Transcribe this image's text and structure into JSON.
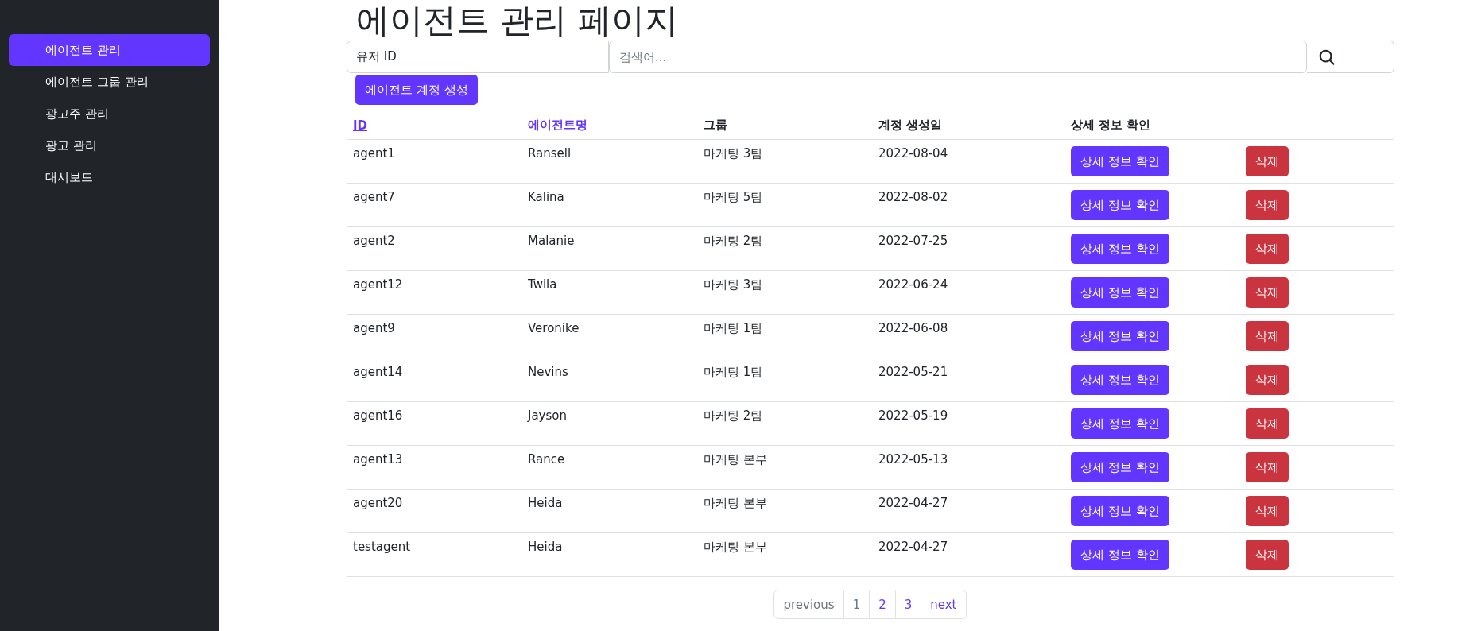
{
  "sidebar": {
    "items": [
      {
        "label": "에이전트 관리",
        "selected": true
      },
      {
        "label": "에이전트 그룹 관리",
        "selected": false
      },
      {
        "label": "광고주 관리",
        "selected": false
      },
      {
        "label": "광고 관리",
        "selected": false
      },
      {
        "label": "대시보드",
        "selected": false
      }
    ]
  },
  "page_title": "에이전트 관리 페이지",
  "search": {
    "filter_value": "유저 ID",
    "placeholder": "검색어..."
  },
  "create_button": "에이전트 계정 생성",
  "table": {
    "columns": [
      {
        "label": "ID",
        "sortable": true
      },
      {
        "label": "에이전트명",
        "sortable": true
      },
      {
        "label": "그룹",
        "sortable": false
      },
      {
        "label": "계정 생성일",
        "sortable": false
      },
      {
        "label": "상세 정보 확인",
        "sortable": false
      }
    ],
    "rows": [
      {
        "id": "agent1",
        "name": "Ransell",
        "group": "마케팅 3팀",
        "created": "2022-08-04",
        "detail": "상세 정보 확인",
        "delete": "삭제"
      },
      {
        "id": "agent7",
        "name": "Kalina",
        "group": "마케팅 5팀",
        "created": "2022-08-02",
        "detail": "상세 정보 확인",
        "delete": "삭제"
      },
      {
        "id": "agent2",
        "name": "Malanie",
        "group": "마케팅 2팀",
        "created": "2022-07-25",
        "detail": "상세 정보 확인",
        "delete": "삭제"
      },
      {
        "id": "agent12",
        "name": "Twila",
        "group": "마케팅 3팀",
        "created": "2022-06-24",
        "detail": "상세 정보 확인",
        "delete": "삭제"
      },
      {
        "id": "agent9",
        "name": "Veronike",
        "group": "마케팅 1팀",
        "created": "2022-06-08",
        "detail": "상세 정보 확인",
        "delete": "삭제"
      },
      {
        "id": "agent14",
        "name": "Nevins",
        "group": "마케팅 1팀",
        "created": "2022-05-21",
        "detail": "상세 정보 확인",
        "delete": "삭제"
      },
      {
        "id": "agent16",
        "name": "Jayson",
        "group": "마케팅 2팀",
        "created": "2022-05-19",
        "detail": "상세 정보 확인",
        "delete": "삭제"
      },
      {
        "id": "agent13",
        "name": "Rance",
        "group": "마케팅 본부",
        "created": "2022-05-13",
        "detail": "상세 정보 확인",
        "delete": "삭제"
      },
      {
        "id": "agent20",
        "name": "Heida",
        "group": "마케팅 본부",
        "created": "2022-04-27",
        "detail": "상세 정보 확인",
        "delete": "삭제"
      },
      {
        "id": "testagent",
        "name": "Heida",
        "group": "마케팅 본부",
        "created": "2022-04-27",
        "detail": "상세 정보 확인",
        "delete": "삭제"
      }
    ]
  },
  "pagination": [
    {
      "kind": "nav",
      "label": "previous",
      "disabled": true
    },
    {
      "kind": "page",
      "label": "1",
      "selected": true
    },
    {
      "kind": "page",
      "label": "2",
      "selected": false
    },
    {
      "kind": "page",
      "label": "3",
      "selected": false
    },
    {
      "kind": "nav",
      "label": "next",
      "disabled": false
    }
  ]
}
